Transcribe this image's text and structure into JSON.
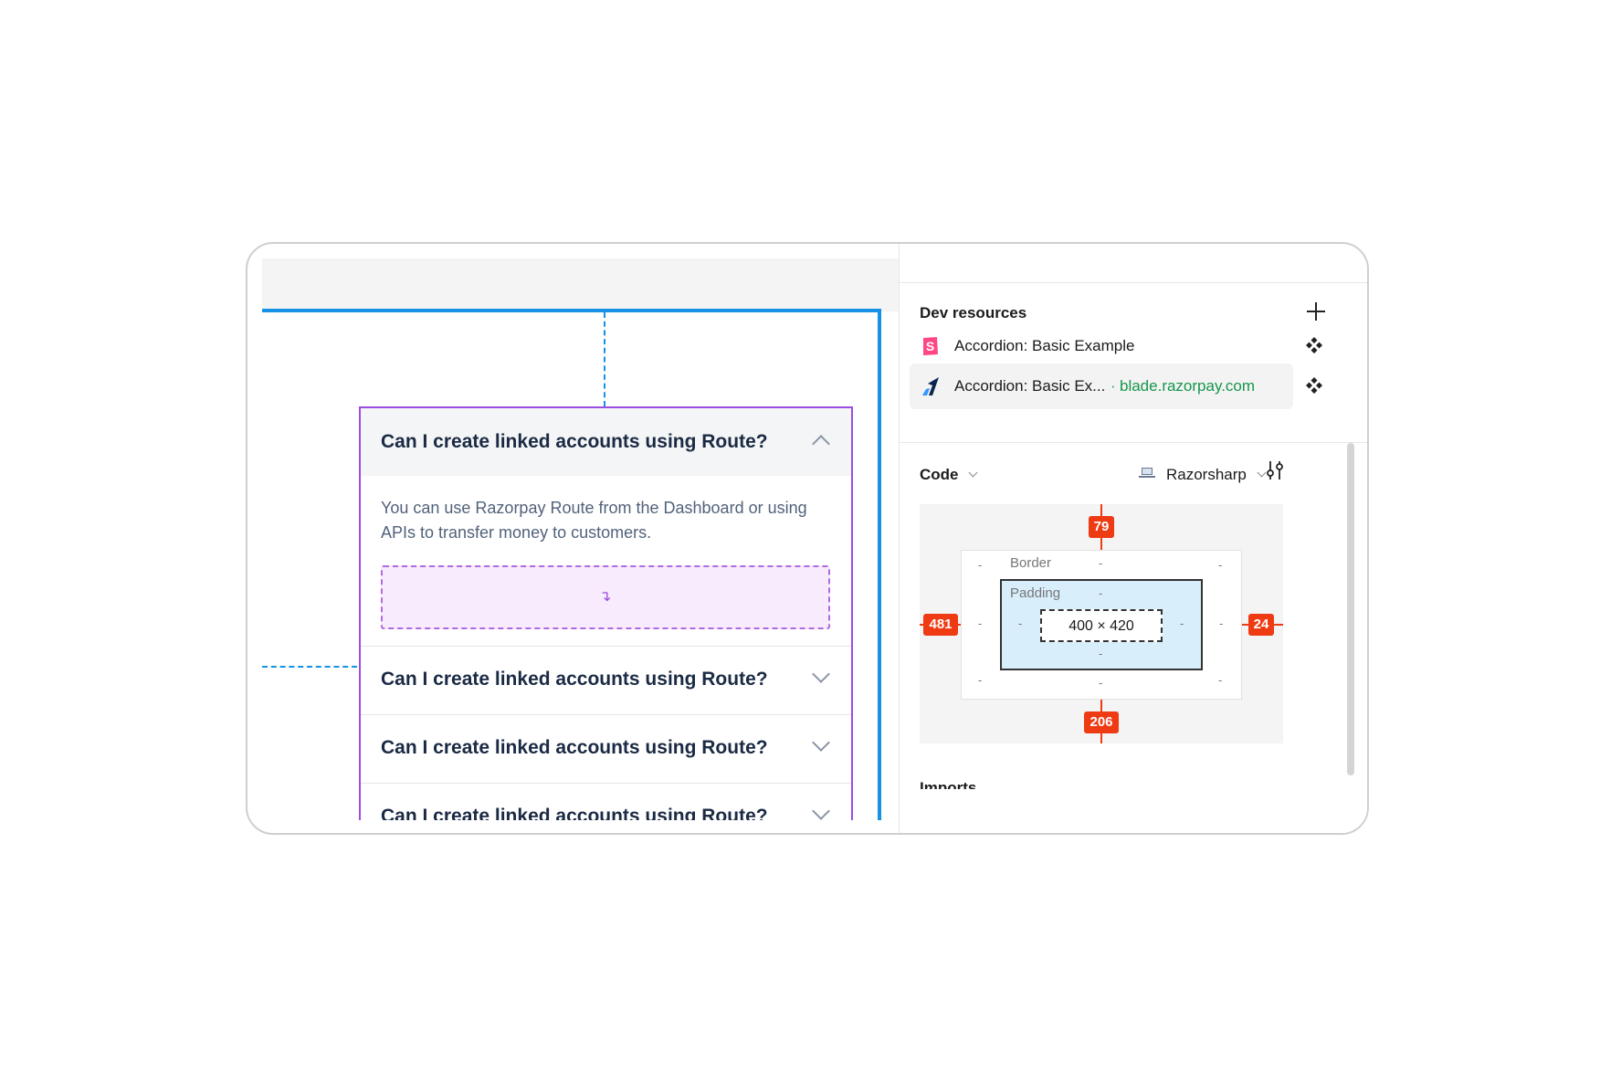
{
  "canvas": {
    "accordion": {
      "expanded_question": "Can I create linked accounts using Route?",
      "expanded_answer": "You can use Razorpay Route from the Dashboard or using APIs to transfer money to customers.",
      "slot_icon": "↴",
      "questions": [
        "Can I create linked accounts using Route?",
        "Can I create linked accounts using Route?",
        "Can I create linked accounts using Route?"
      ]
    }
  },
  "panel": {
    "dev_resources": {
      "title": "Dev resources",
      "items": [
        {
          "label": "Accordion: Basic Example",
          "icon": "storybook-icon"
        },
        {
          "label": "Accordion: Basic Ex...",
          "separator": "·",
          "link": "blade.razorpay.com",
          "icon": "razorpay-icon"
        }
      ]
    },
    "code": {
      "title": "Code",
      "language": "Razorsharp"
    },
    "box_model": {
      "border_label": "Border",
      "padding_label": "Padding",
      "content_size": "400 × 420",
      "dash": "-",
      "margin_top": "79",
      "margin_left": "481",
      "margin_right": "24",
      "margin_bottom": "206"
    },
    "imports_title": "Imports"
  },
  "colors": {
    "selection_blue": "#1592e6",
    "component_purple": "#9b4dde",
    "measure_red": "#ee3b14",
    "link_green": "#14964a"
  }
}
